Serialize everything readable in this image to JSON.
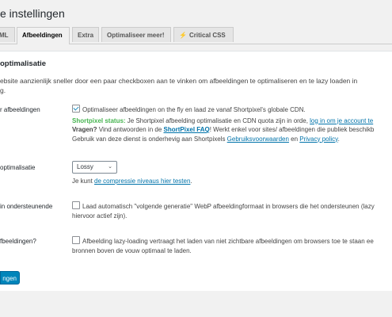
{
  "page": {
    "title": "e instellingen"
  },
  "tabs": [
    {
      "label": "ML",
      "active": false
    },
    {
      "label": "Afbeeldingen",
      "active": true
    },
    {
      "label": "Extra",
      "active": false
    },
    {
      "label": "Optimaliseer meer!",
      "active": false
    },
    {
      "label": "Critical CSS",
      "active": false,
      "icon": "bolt-icon"
    }
  ],
  "section": {
    "title": "optimalisatie",
    "intro": "ebsite aanzienlijk sneller door een paar checkboxen aan te vinken om afbeeldingen te optimaliseren en te lazy loaden in",
    "intro_line2": "g."
  },
  "rows": {
    "optimize": {
      "label": "r afbeeldingen",
      "checkbox_label": "Optimaliseer afbeeldingen on the fly en laad ze vanaf Shortpixel's globale CDN.",
      "checked": true,
      "status_key": "Shortpixel status:",
      "status_text": " Je Shortpixel afbeelding optimalisatie en CDN quota zijn in orde, ",
      "status_link": "log in om je account te",
      "questions_key": "Vragen?",
      "questions_text": " Vind antwoorden in de ",
      "faq_link": "ShortPixel FAQ",
      "questions_text2": "! Werkt enkel voor sites/ afbeeldingen die publiek beschikb",
      "terms_text": "Gebruik van deze dienst is onderhevig aan Shortpixels ",
      "terms_link": "Gebruiksvoorwaarden",
      "terms_and": " en ",
      "privacy_link": "Privacy policy",
      "terms_end": "."
    },
    "compression": {
      "label": "optimalisatie",
      "select_value": "Lossy",
      "help_prefix": "Je kunt ",
      "help_link": "de compressie niveaus hier testen",
      "help_suffix": "."
    },
    "webp": {
      "label": "in ondersteunende",
      "checkbox_label": "Laad automatisch \"volgende generatie\" WebP afbeeldingformaat in browsers die het ondersteunen (lazy",
      "line2": "hiervoor actief zijn).",
      "checked": false
    },
    "lazyload": {
      "label": "fbeeldingen?",
      "checkbox_label": "Afbeelding lazy-loading vertraagt het laden van niet zichtbare afbeeldingen om browsers toe te staan ee",
      "line2": "bronnen boven de vouw optimaal te laden.",
      "checked": false
    }
  },
  "save_button": {
    "label": "ngen"
  },
  "colors": {
    "accent": "#0085ba",
    "link": "#0073aa",
    "status_green": "#46b450"
  }
}
